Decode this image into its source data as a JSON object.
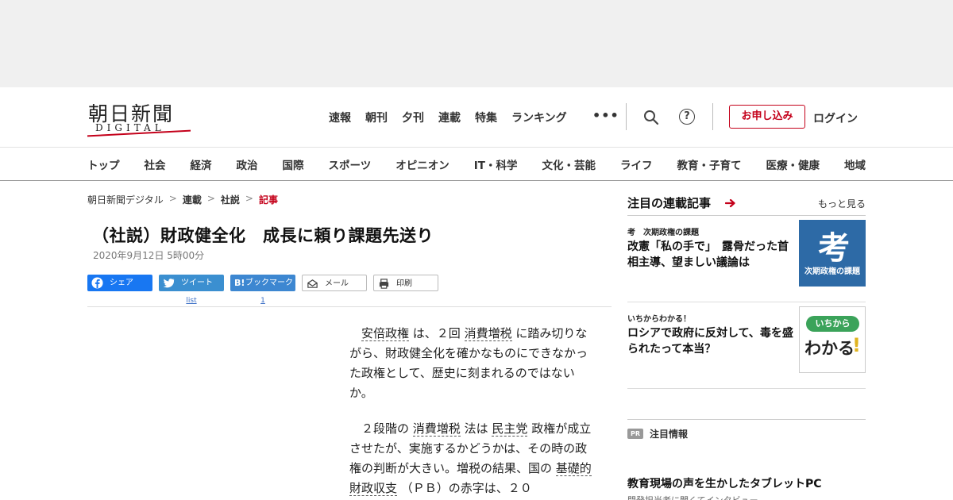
{
  "logo": {
    "main": "朝日新聞",
    "sub": "DIGITAL"
  },
  "top_nav": [
    "速報",
    "朝刊",
    "夕刊",
    "連載",
    "特集",
    "ランキング"
  ],
  "more_dots": "•••",
  "actions": {
    "help": "?",
    "apply": "お申し込み",
    "login": "ログイン"
  },
  "categories": [
    "トップ",
    "社会",
    "経済",
    "政治",
    "国際",
    "スポーツ",
    "オピニオン",
    "IT・科学",
    "文化・芸能",
    "ライフ",
    "教育・子育て",
    "医療・健康",
    "地域"
  ],
  "breadcrumb": [
    "朝日新聞デジタル",
    "連載",
    "社説",
    "記事"
  ],
  "breadcrumb_sep": ">",
  "article": {
    "title": "（社説）財政健全化　成長に頼り課題先送り",
    "date": "2020年9月12日 5時00分"
  },
  "share": {
    "facebook": "シェア",
    "twitter": "ツイート",
    "twitter_count": "list",
    "hatena_mark": "B!",
    "hatena": "ブックマーク",
    "hatena_count": "1",
    "mail": "メール",
    "print": "印刷"
  },
  "body": {
    "p1": {
      "k1": "安倍政権",
      "t1": "は、２回",
      "k2": "消費増税",
      "t2": "に踏み切りながら、財政健全化を確かなものにできなかった政権として、歴史に刻まれるのではないか。"
    },
    "p2": {
      "t0": "２段階の",
      "k1": "消費増税",
      "t1": "法は",
      "k2": "民主党",
      "t2": "政権が成立させたが、実施するかどうかは、その時の政権の判断が大きい。増税の結果、国の",
      "k3": "基礎的財政収支",
      "t3": "（ＰＢ）の赤字は、２０"
    }
  },
  "sidebar": {
    "heading": "注目の連載記事",
    "more": "もっと見る",
    "items": [
      {
        "kicker": "考　次期政権の課題",
        "headline": "改憲「私の手で」　露骨だった首相主導、望ましい議論は",
        "thumb_big": "考",
        "thumb_caption": "次期政権の課題"
      },
      {
        "kicker": "いちからわかる！",
        "headline": "ロシアで政府に反対して、毒を盛られたって本当？",
        "thumb_pill": "いちから",
        "thumb_word": "わかる",
        "thumb_mark": "!"
      }
    ],
    "pr_badge": "PR",
    "pr_label": "注目情報",
    "pr_item": "教育現場の声を生かしたタブレットPC",
    "pr_sub": "開発担当者に聞くてインタビュー"
  },
  "colors": {
    "brand_red": "#c4001a",
    "facebook": "#1877f2",
    "twitter": "#3b8fd0",
    "hatena": "#3d87d1"
  }
}
